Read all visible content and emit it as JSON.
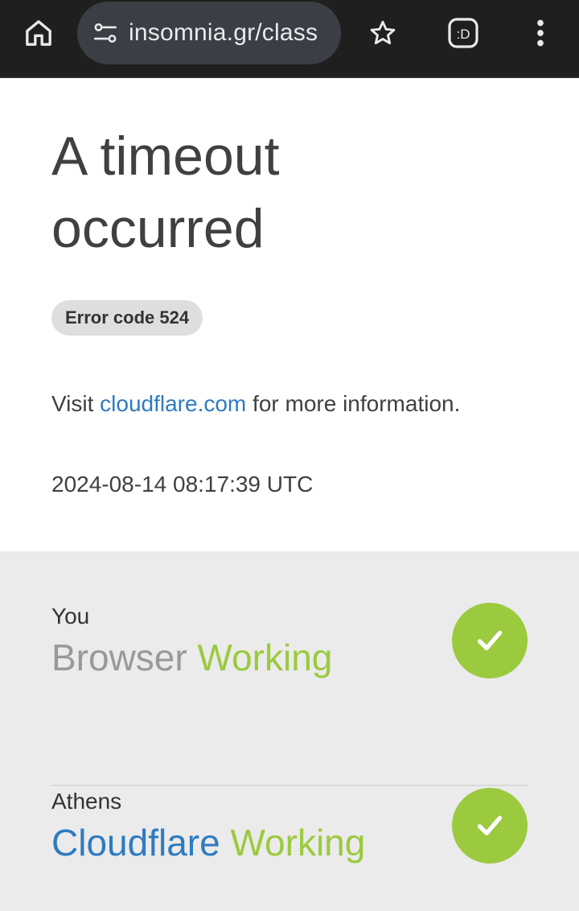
{
  "browser": {
    "url": "insomnia.gr/class",
    "icons": {
      "home": "home-icon",
      "site_info": "tune-icon",
      "bookmark": "star-outline-icon",
      "extension": "extension-smiley-icon",
      "menu": "more-vert-icon"
    },
    "extension_label": ":D"
  },
  "error": {
    "title_line1": "A timeout",
    "title_line2": "occurred",
    "code_badge": "Error code 524",
    "visit_prefix": "Visit ",
    "visit_link": "cloudflare.com",
    "visit_suffix": " for more information.",
    "timestamp": "2024-08-14 08:17:39 UTC"
  },
  "status": {
    "items": [
      {
        "location": "You",
        "name": "Browser",
        "state": "Working",
        "icon": "check-icon"
      },
      {
        "location": "Athens",
        "name": "Cloudflare",
        "state": "Working",
        "icon": "check-icon"
      }
    ]
  },
  "colors": {
    "topbar": "#1f1f1f",
    "urlbar": "#3b3f45",
    "link_blue": "#2f7bbf",
    "ok_green": "#9bca3e",
    "status_bg": "#ebebeb",
    "badge_bg": "#dedede"
  }
}
